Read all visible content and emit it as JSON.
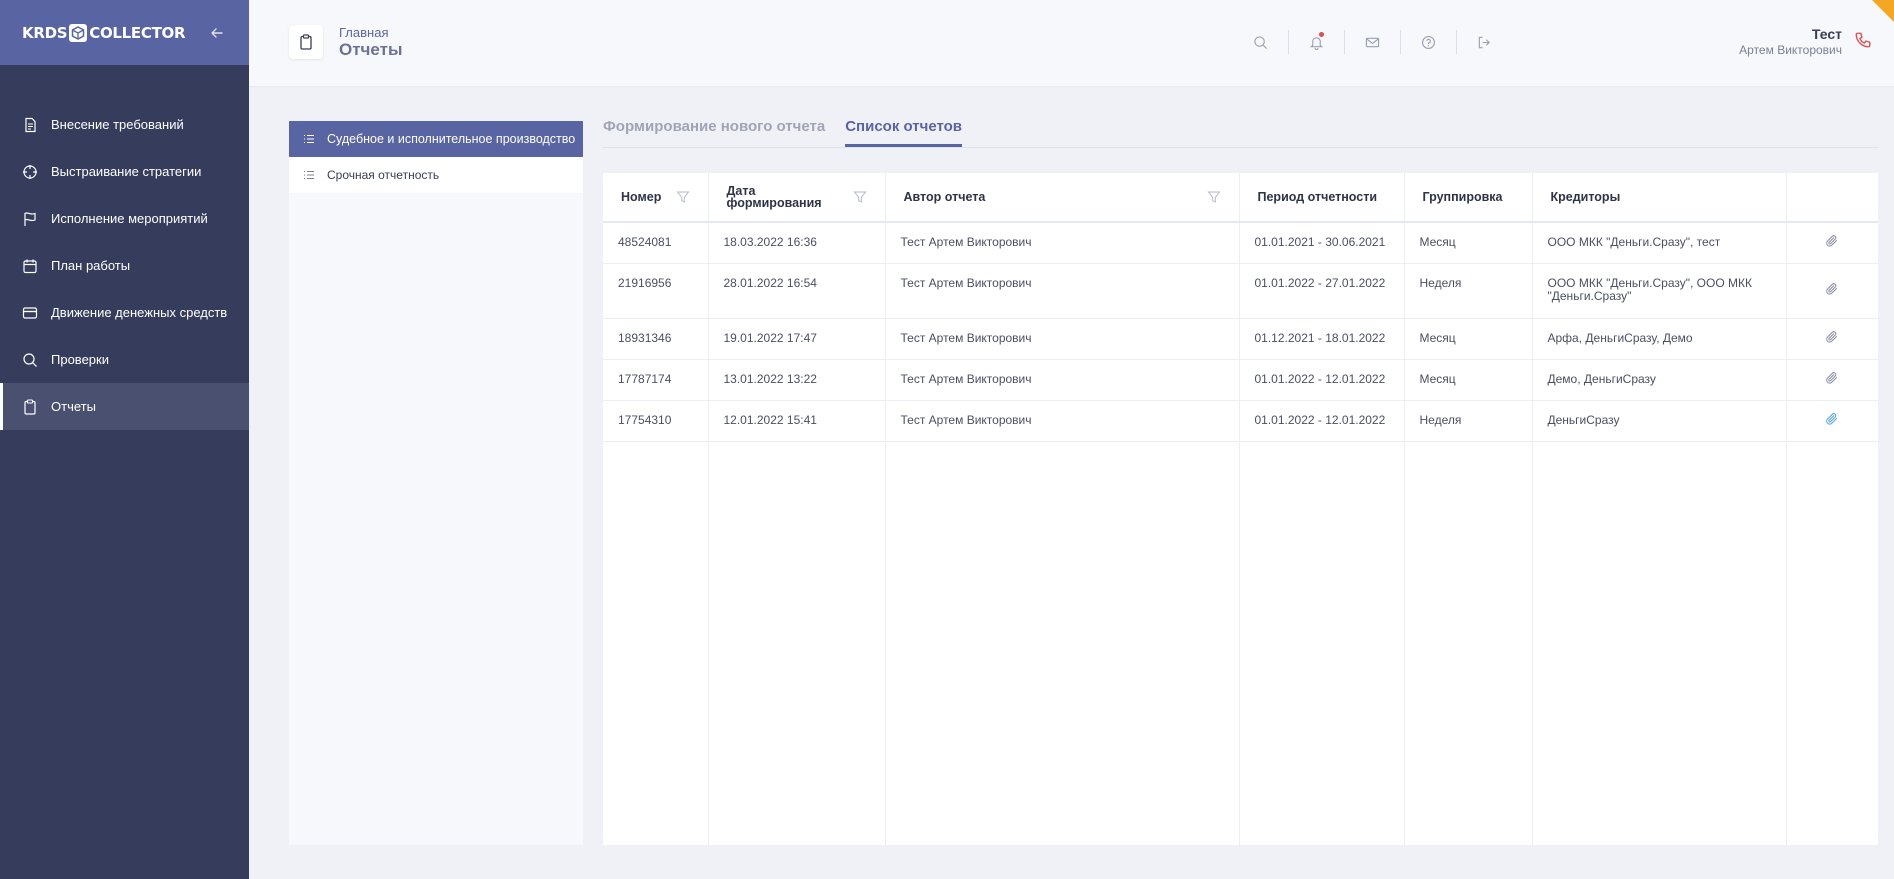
{
  "app": {
    "logo_left": "KRDS",
    "logo_right": "COLLECTOR"
  },
  "sidebar": {
    "items": [
      {
        "label": "Внесение требований",
        "icon": "document-icon"
      },
      {
        "label": "Выстраивание стратегии",
        "icon": "crosshair-icon"
      },
      {
        "label": "Исполнение мероприятий",
        "icon": "flag-icon"
      },
      {
        "label": "План работы",
        "icon": "calendar-icon"
      },
      {
        "label": "Движение денежных средств",
        "icon": "credit-card-icon"
      },
      {
        "label": "Проверки",
        "icon": "search-icon"
      },
      {
        "label": "Отчеты",
        "icon": "clipboard-icon",
        "active": true
      }
    ]
  },
  "header": {
    "breadcrumb": "Главная",
    "title": "Отчеты",
    "user_name": "Тест",
    "user_sub": "Артем Викторович"
  },
  "left_panel": {
    "items": [
      {
        "label": "Судебное и исполнительное производство",
        "active": true
      },
      {
        "label": "Срочная отчетность",
        "active": false
      }
    ]
  },
  "tabs": [
    {
      "label": "Формирование нового отчета",
      "active": false
    },
    {
      "label": "Список отчетов",
      "active": true
    }
  ],
  "table": {
    "columns": {
      "number": "Номер",
      "date_line1": "Дата",
      "date_line2": "формирования",
      "author": "Автор отчета",
      "period": "Период отчетности",
      "grouping": "Группировка",
      "creditors": "Кредиторы"
    },
    "rows": [
      {
        "number": "48524081",
        "date": "18.03.2022 16:36",
        "author": "Тест Артем Викторович",
        "period": "01.01.2021 - 30.06.2021",
        "grouping": "Месяц",
        "creditors": "ООО МКК \"Деньги.Сразу\", тест"
      },
      {
        "number": "21916956",
        "date": "28.01.2022 16:54",
        "author": "Тест Артем Викторович",
        "period": "01.01.2022 - 27.01.2022",
        "grouping": "Неделя",
        "creditors": "ООО МКК \"Деньги.Сразу\", ООО МКК \"Деньги.Сразу\""
      },
      {
        "number": "18931346",
        "date": "19.01.2022 17:47",
        "author": "Тест Артем Викторович",
        "period": "01.12.2021 - 18.01.2022",
        "grouping": "Месяц",
        "creditors": "Арфа, ДеньгиСразу, Демо"
      },
      {
        "number": "17787174",
        "date": "13.01.2022 13:22",
        "author": "Тест Артем Викторович",
        "period": "01.01.2022 - 12.01.2022",
        "grouping": "Месяц",
        "creditors": "Демо, ДеньгиСразу"
      },
      {
        "number": "17754310",
        "date": "12.01.2022 15:41",
        "author": "Тест Артем Викторович",
        "period": "01.01.2022 - 12.01.2022",
        "grouping": "Неделя",
        "creditors": "ДеньгиСразу"
      }
    ]
  },
  "colors": {
    "sidebar_bg": "#363d5c",
    "accent": "#5965a3",
    "clip_highlight": "#5aa9e6",
    "phone": "#e24c4c"
  }
}
